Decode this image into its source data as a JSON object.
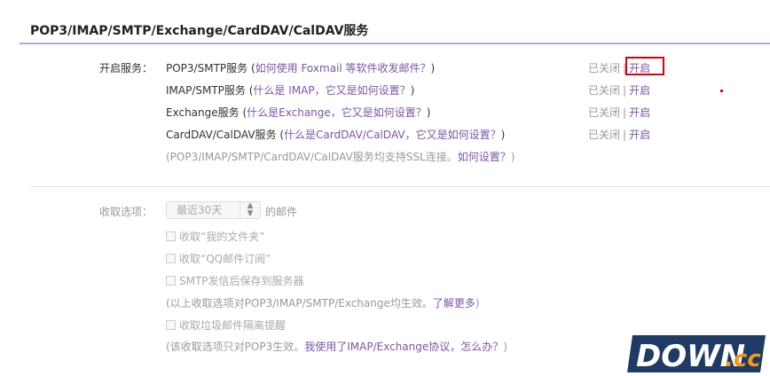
{
  "section": {
    "title": "POP3/IMAP/SMTP/Exchange/CardDAV/CalDAV服务"
  },
  "services": {
    "label": "开启服务：",
    "items": [
      {
        "name": "POP3/SMTP服务",
        "help_open": " (",
        "help": "如何使用 Foxmail 等软件收发邮件？",
        "help_close": ")",
        "status": "已关闭",
        "sep": "|",
        "action": "开启"
      },
      {
        "name": "IMAP/SMTP服务",
        "help_open": " (",
        "help": "什么是 IMAP，它又是如何设置？",
        "help_close": ")",
        "status": "已关闭",
        "sep": "|",
        "action": "开启"
      },
      {
        "name": "Exchange服务",
        "help_open": " (",
        "help": "什么是Exchange，它又是如何设置？",
        "help_close": ")",
        "status": "已关闭",
        "sep": "|",
        "action": "开启"
      },
      {
        "name": "CardDAV/CalDAV服务",
        "help_open": " (",
        "help": "什么是CardDAV/CalDAV，它又是如何设置？",
        "help_close": ")",
        "status": "已关闭",
        "sep": "|",
        "action": "开启"
      }
    ],
    "ssl_note": "(POP3/IMAP/SMTP/CardDAV/CalDAV服务均支持SSL连接。",
    "ssl_link": "如何设置？",
    "ssl_note_end": ")"
  },
  "fetch_options": {
    "label": "收取选项：",
    "range_select": {
      "value": "最近30天",
      "suffix": "的邮件"
    },
    "checkboxes": [
      {
        "label": "收取“我的文件夹”"
      },
      {
        "label": "收取“QQ邮件订阅”"
      },
      {
        "label": "SMTP发信后保存到服务器"
      }
    ],
    "note1": "(以上收取选项对POP3/IMAP/SMTP/Exchange均生效。",
    "note1_link": "了解更多",
    "note1_end": ")",
    "spam_checkbox": {
      "label": "收取垃圾邮件隔离提醒"
    },
    "note2": "(该收取选项只对POP3生效。",
    "note2_link": "我使用了IMAP/Exchange协议，怎么办？",
    "note2_end": ")"
  },
  "watermark": {
    "text": "DOWN",
    "suffix": ".cc"
  },
  "colors": {
    "accent": "#7a56a8",
    "highlight_box": "#d9000d",
    "underline": "#b9a6d4"
  }
}
